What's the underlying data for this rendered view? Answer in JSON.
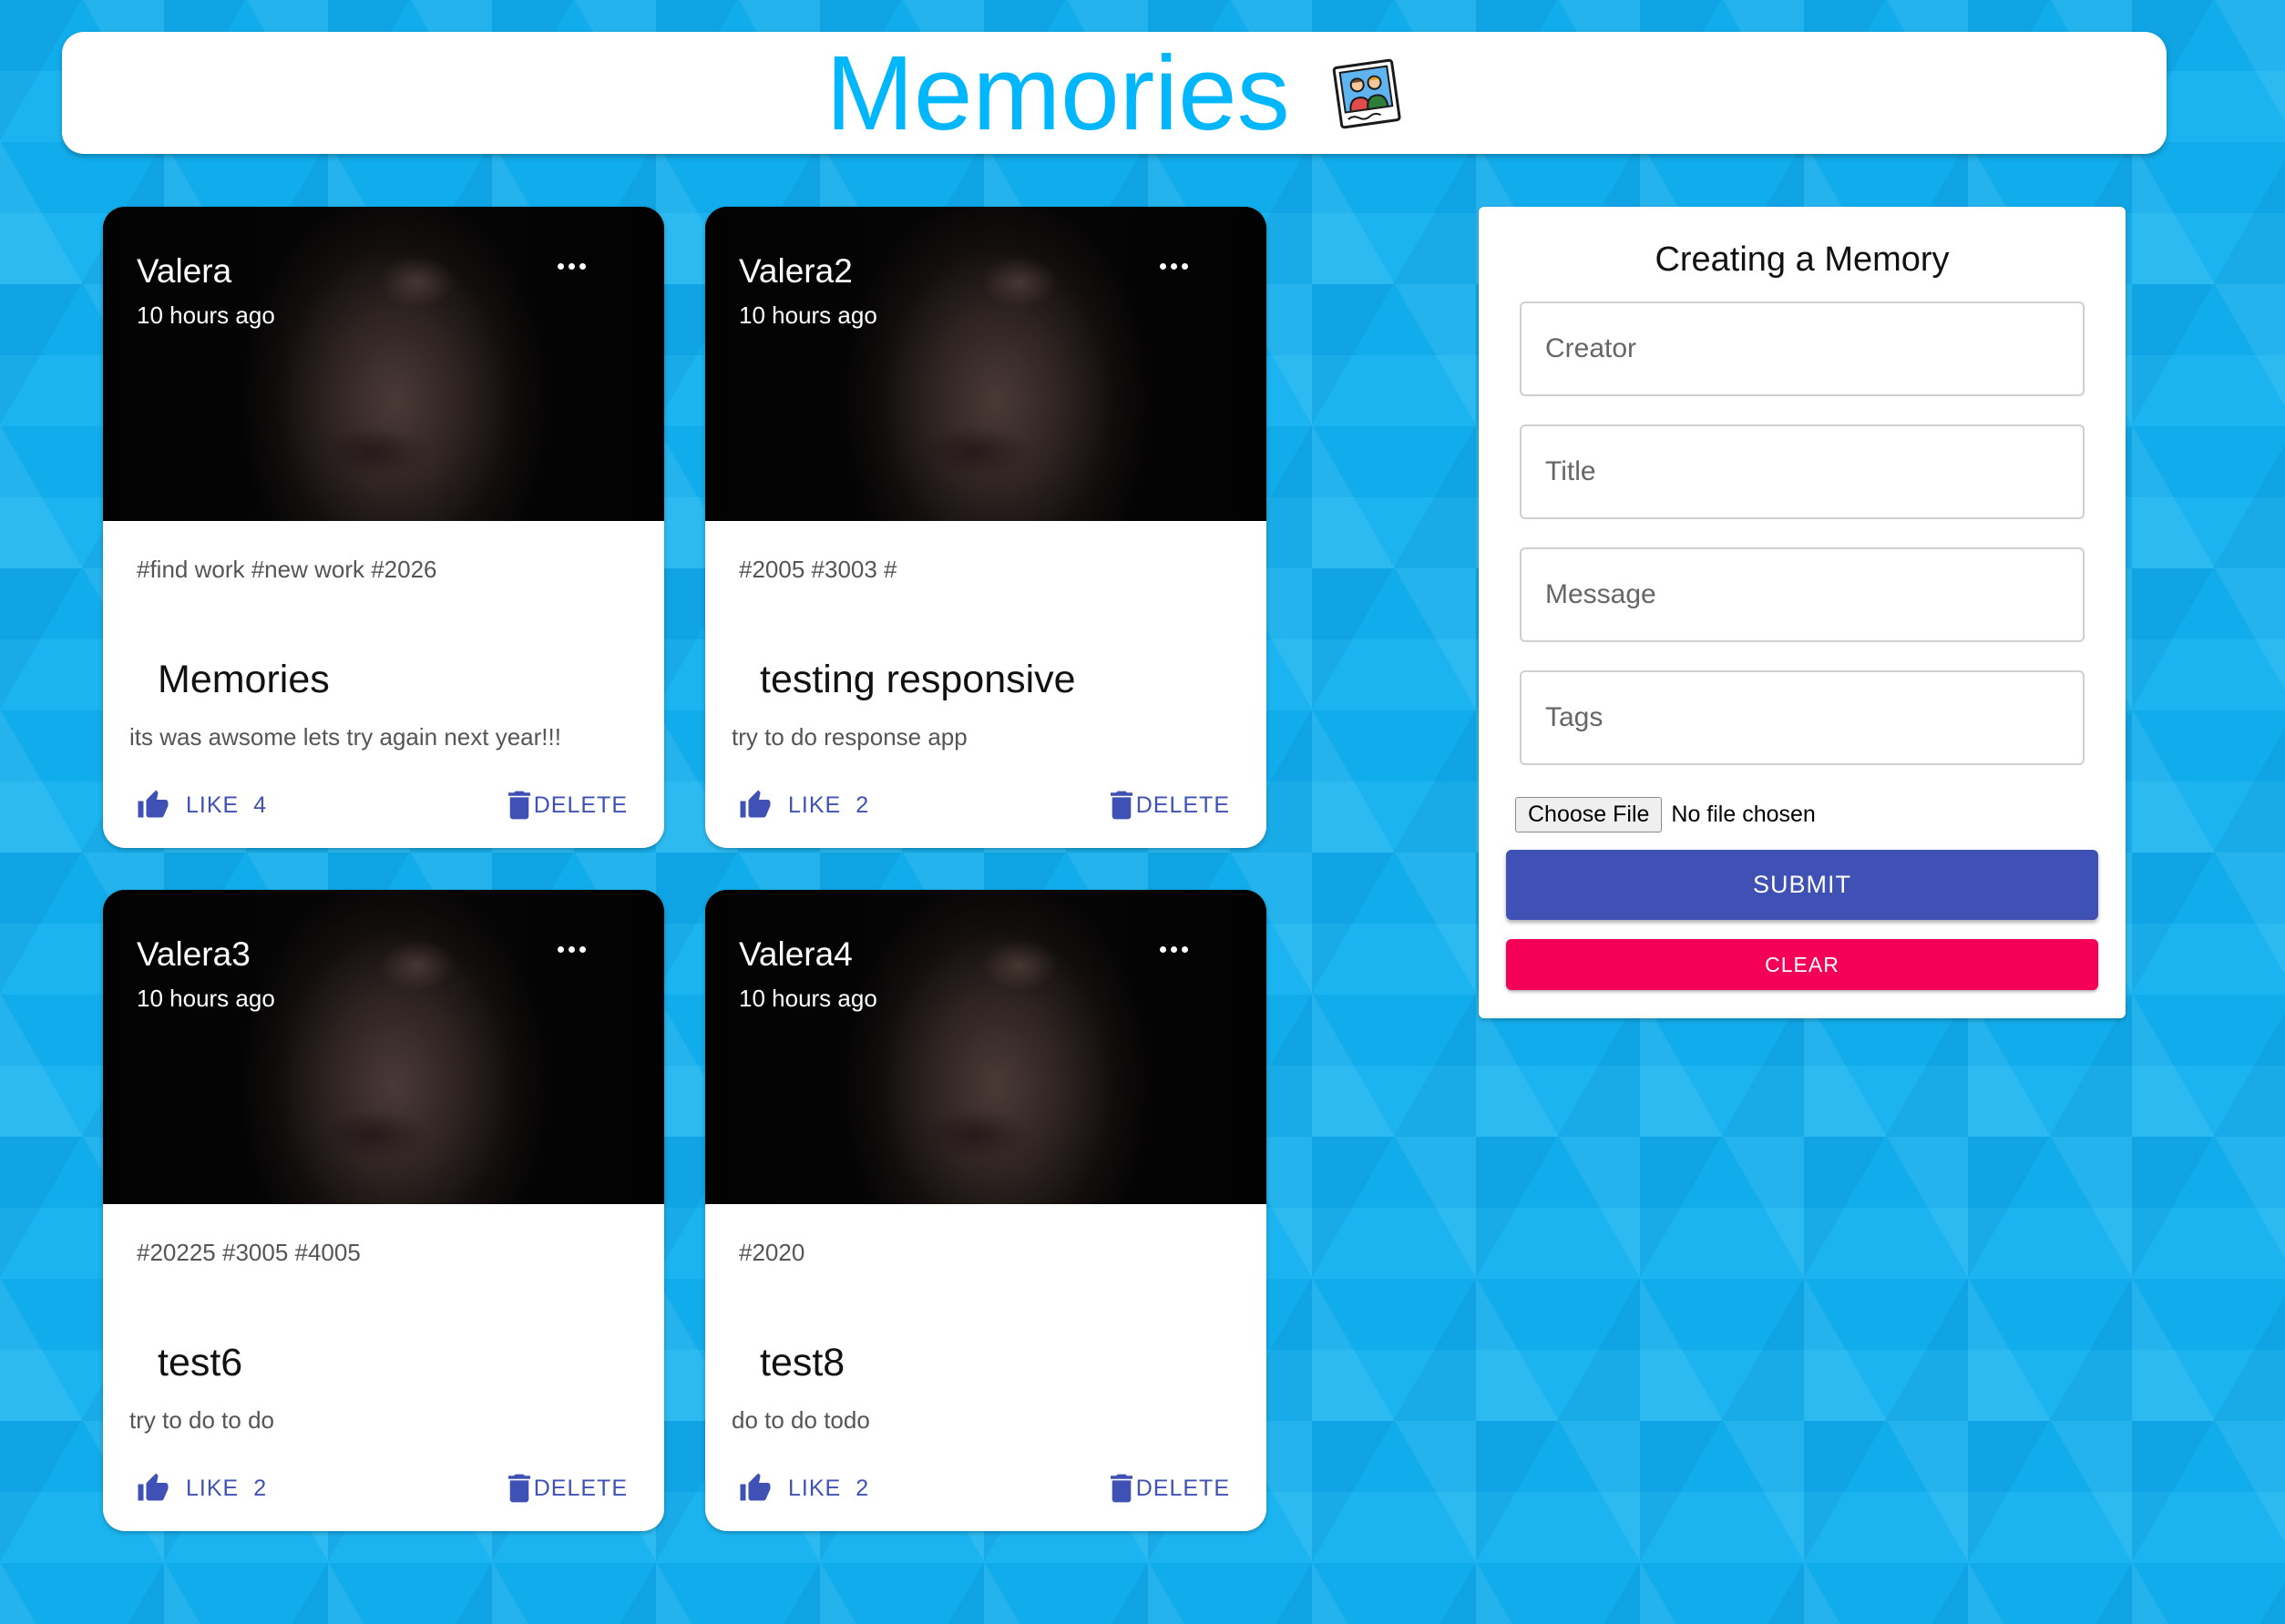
{
  "header": {
    "title": "Memories",
    "logo_icon": "memories-photo-icon"
  },
  "posts": [
    {
      "creator": "Valera",
      "time": "10 hours ago",
      "tags": "#find work #new work #2026",
      "title": "Memories",
      "message": "its was awsome lets try again next year!!!",
      "like_label": "LIKE",
      "like_count": "4",
      "delete_label": "DELETE"
    },
    {
      "creator": "Valera2",
      "time": "10 hours ago",
      "tags": "#2005 #3003 #",
      "title": "testing responsive",
      "message": "try to do response app",
      "like_label": "LIKE",
      "like_count": "2",
      "delete_label": "DELETE"
    },
    {
      "creator": "Valera3",
      "time": "10 hours ago",
      "tags": "#20225 #3005 #4005",
      "title": "test6",
      "message": "try to do to do",
      "like_label": "LIKE",
      "like_count": "2",
      "delete_label": "DELETE"
    },
    {
      "creator": "Valera4",
      "time": "10 hours ago",
      "tags": "#2020",
      "title": "test8",
      "message": "do to do todo",
      "like_label": "LIKE",
      "like_count": "2",
      "delete_label": "DELETE"
    }
  ],
  "form": {
    "heading": "Creating a Memory",
    "creator_placeholder": "Creator",
    "title_placeholder": "Title",
    "message_placeholder": "Message",
    "tags_placeholder": "Tags",
    "file_button_label": "Choose File",
    "file_status": "No file chosen",
    "submit_label": "SUBMIT",
    "clear_label": "CLEAR"
  },
  "colors": {
    "accent": "#3f51b5",
    "secondary": "#f50057",
    "title": "#00b7fe",
    "background": "#12b1ef"
  }
}
